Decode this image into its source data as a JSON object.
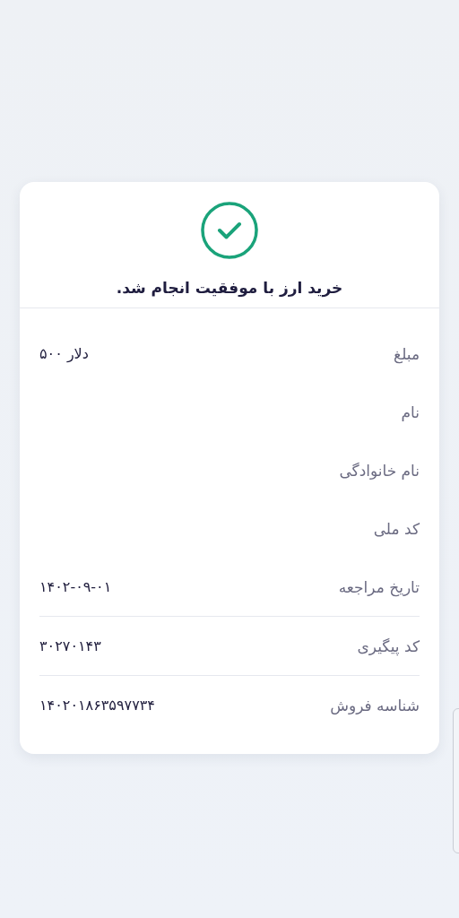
{
  "receipt": {
    "title": "خرید ارز با موفقیت انجام شد.",
    "groups": [
      {
        "rows": [
          {
            "label": "مبلغ",
            "value": "۵۰۰ دلار"
          },
          {
            "label": "نام"
          },
          {
            "label": "نام خانوادگی"
          },
          {
            "label": "کد ملی"
          },
          {
            "label": "تاریخ مراجعه",
            "value": "۱۴۰۲-۰۹-۰۱"
          }
        ]
      },
      {
        "rows": [
          {
            "label": "کد پیگیری",
            "value": "۳۰۲۷۰۱۴۳"
          }
        ]
      },
      {
        "rows": [
          {
            "label": "شناسه فروش",
            "value": "۱۴۰۲۰۱۸۶۳۵۹۷۷۳۴"
          }
        ]
      }
    ]
  }
}
